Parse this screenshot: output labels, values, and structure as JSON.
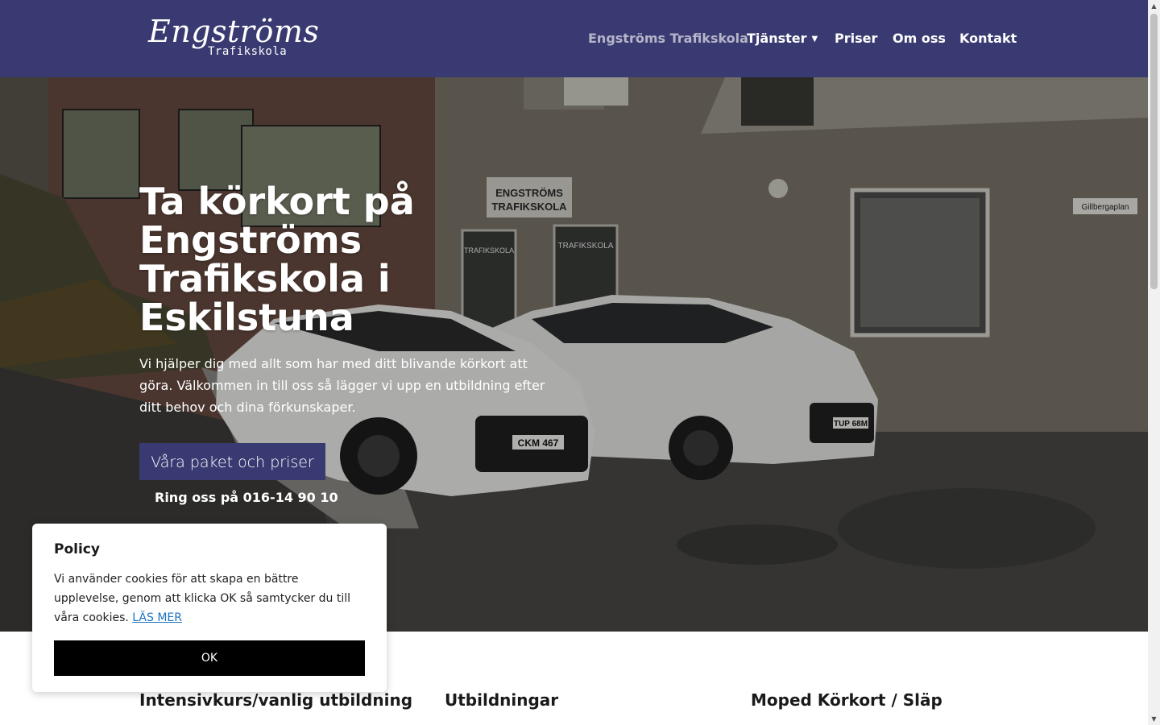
{
  "header": {
    "logo_script": "Engströms",
    "logo_sub": "Trafikskola",
    "nav": [
      {
        "label": "Engströms Trafikskola",
        "active": true
      },
      {
        "label": "Tjänster",
        "has_dropdown": true
      },
      {
        "label": "Priser"
      },
      {
        "label": "Om oss"
      },
      {
        "label": "Kontakt"
      }
    ]
  },
  "hero": {
    "title": "Ta körkort på Engströms Trafikskola i Eskilstuna",
    "text": "Vi hjälper dig med allt som har med ditt blivande körkort att göra. Välkommen in till oss så lägger vi upp en utbildning efter ditt behov och dina förkunskaper.",
    "cta_label": "Våra paket och priser",
    "phone_label": "Ring oss på 016-14 90 10",
    "sign_line1": "ENGSTRÖMS",
    "sign_line2": "TRAFIKSKOLA",
    "window_label_1": "TRAFIKSKOLA",
    "window_label_2": "TRAFIKSKOLA",
    "street_sign": "Gillbergaplan",
    "plate_1": "CKM 467",
    "plate_2": "TUP 68M"
  },
  "columns": [
    {
      "title": "Intensivkurs/vanlig utbildning"
    },
    {
      "title": "Utbildningar"
    },
    {
      "title": "Moped Körkort / Släp"
    }
  ],
  "cookie": {
    "title": "Policy",
    "text": "Vi använder cookies för att skapa en bättre upplevelse, genom att klicka OK så samtycker du till våra cookies.",
    "link_label": "LÄS MER",
    "ok_label": "OK"
  },
  "colors": {
    "brand": "#3a3a72",
    "link": "#1e73be"
  }
}
